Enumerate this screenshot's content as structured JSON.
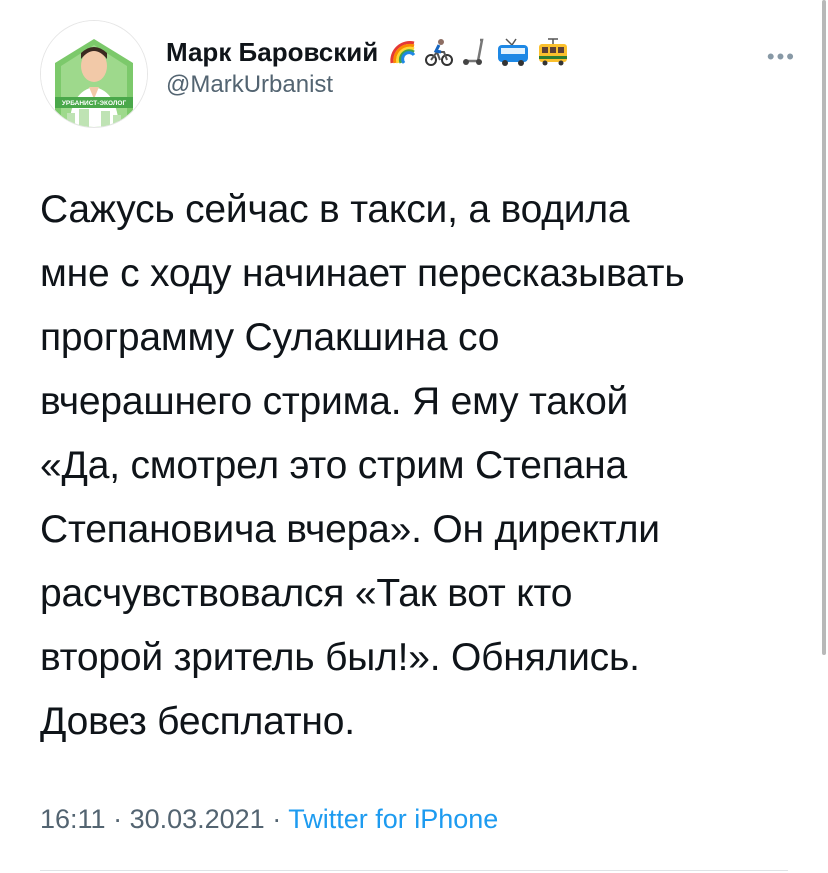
{
  "user": {
    "display_name": "Марк Баровский",
    "handle": "@MarkUrbanist",
    "avatar_caption": "УРБАНИСТ-ЭКОЛОГ",
    "emoji_icons": [
      "rainbow-icon",
      "cyclist-icon",
      "scooter-icon",
      "trolleybus-icon",
      "tram-icon"
    ]
  },
  "tweet": {
    "text": "Сажусь сейчас в такси, а водила\nмне с ходу начинает пересказывать\nпрограмму Сулакшина со\nвчерашнего стрима. Я ему такой\n«Да, смотрел это стрим Степана\nСтепановича вчера». Он директли\nрасчувствовался «Так вот кто\nвторой зритель был!». Обнялись.\nДовез бесплатно."
  },
  "meta": {
    "time": "16:11",
    "separator": " · ",
    "date": "30.03.2021",
    "source": "Twitter for iPhone"
  },
  "colors": {
    "text": "#0f1419",
    "secondary": "#536471",
    "link": "#1d9bf0"
  }
}
